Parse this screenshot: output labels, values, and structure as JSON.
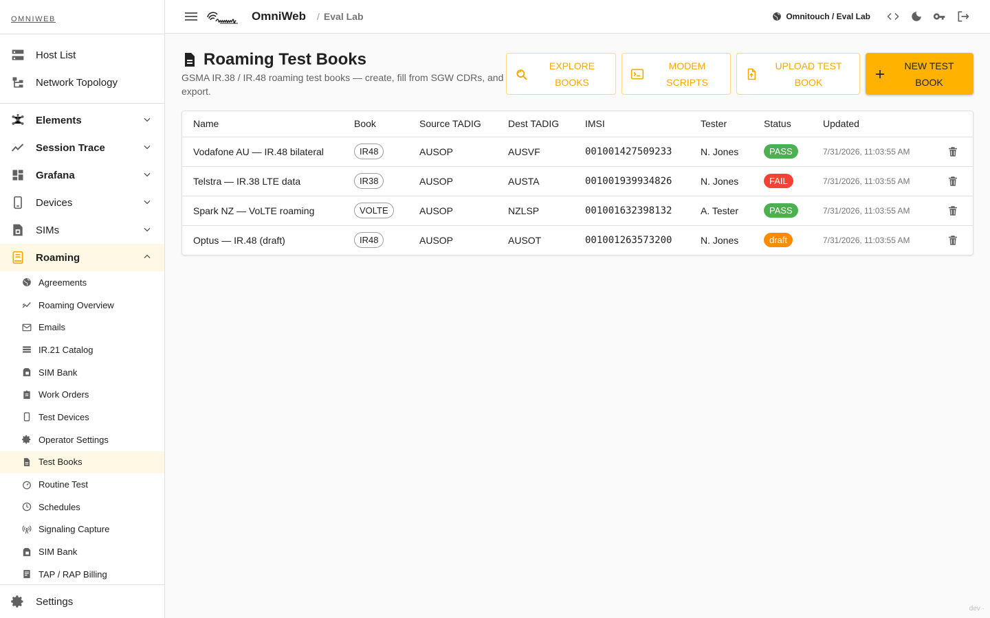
{
  "sidebar": {
    "brand": "OMNIWEB",
    "top_items": [
      {
        "label": "Host List",
        "icon": "server-icon"
      },
      {
        "label": "Network Topology",
        "icon": "topology-icon"
      }
    ],
    "groups": [
      {
        "label": "Elements",
        "icon": "elements-icon",
        "expanded": false
      },
      {
        "label": "Session Trace",
        "icon": "trace-icon",
        "expanded": false
      },
      {
        "label": "Grafana",
        "icon": "dashboard-icon",
        "expanded": false
      },
      {
        "label": "Devices",
        "icon": "device-icon",
        "expanded": false
      },
      {
        "label": "SIMs",
        "icon": "sim-icon",
        "expanded": false
      },
      {
        "label": "Roaming",
        "icon": "roaming-icon",
        "expanded": true
      }
    ],
    "roaming_items": [
      {
        "label": "Agreements",
        "icon": "globe-icon"
      },
      {
        "label": "Roaming Overview",
        "icon": "chart-icon"
      },
      {
        "label": "Emails",
        "icon": "mail-icon"
      },
      {
        "label": "IR.21 Catalog",
        "icon": "list-icon"
      },
      {
        "label": "SIM Bank",
        "icon": "sim-card-icon"
      },
      {
        "label": "Work Orders",
        "icon": "clipboard-icon"
      },
      {
        "label": "Test Devices",
        "icon": "phone-icon"
      },
      {
        "label": "Operator Settings",
        "icon": "gear-icon"
      },
      {
        "label": "Test Books",
        "icon": "document-icon",
        "active": true
      },
      {
        "label": "Routine Test",
        "icon": "speedometer-icon"
      },
      {
        "label": "Schedules",
        "icon": "clock-icon"
      },
      {
        "label": "Signaling Capture",
        "icon": "antenna-icon"
      },
      {
        "label": "SIM Bank",
        "icon": "sim-card-icon"
      },
      {
        "label": "TAP / RAP Billing",
        "icon": "receipt-icon"
      }
    ],
    "footer": {
      "label": "Settings",
      "icon": "gear-icon"
    }
  },
  "topbar": {
    "app_title": "OmniWeb",
    "breadcrumb_sep": "/",
    "breadcrumb": "Eval Lab",
    "tenant": "Omnitouch / Eval Lab"
  },
  "page": {
    "title": "Roaming Test Books",
    "subtitle": "GSMA IR.38 / IR.48 roaming test books — create, fill from SGW CDRs, and export.",
    "actions": {
      "explore": "Explore Books",
      "modem": "Modem Scripts",
      "upload": "Upload Test Book",
      "new": "New Test Book"
    }
  },
  "table": {
    "headers": [
      "Name",
      "Book",
      "Source TADIG",
      "Dest TADIG",
      "IMSI",
      "Tester",
      "Status",
      "Updated"
    ],
    "rows": [
      {
        "name": "Vodafone AU — IR.48 bilateral",
        "book": "IR48",
        "source": "AUSOP",
        "dest": "AUSVF",
        "imsi": "001001427509233",
        "tester": "N. Jones",
        "status": "PASS",
        "updated": "7/31/2026, 11:03:55 AM"
      },
      {
        "name": "Telstra — IR.38 LTE data",
        "book": "IR38",
        "source": "AUSOP",
        "dest": "AUSTA",
        "imsi": "001001939934826",
        "tester": "N. Jones",
        "status": "FAIL",
        "updated": "7/31/2026, 11:03:55 AM"
      },
      {
        "name": "Spark NZ — VoLTE roaming",
        "book": "VOLTE",
        "source": "AUSOP",
        "dest": "NZLSP",
        "imsi": "001001632398132",
        "tester": "A. Tester",
        "status": "PASS",
        "updated": "7/31/2026, 11:03:55 AM"
      },
      {
        "name": "Optus — IR.48 (draft)",
        "book": "IR48",
        "source": "AUSOP",
        "dest": "AUSOT",
        "imsi": "001001263573200",
        "tester": "N. Jones",
        "status": "draft",
        "updated": "7/31/2026, 11:03:55 AM"
      }
    ]
  },
  "status_colors": {
    "PASS": "#4caf50",
    "FAIL": "#f44336",
    "draft": "#fb8c00"
  },
  "colors": {
    "accent": "#ffb300",
    "accent_text": "#f5a800",
    "active_bg": "#fff8e5"
  },
  "dev_tag": "dev ·"
}
